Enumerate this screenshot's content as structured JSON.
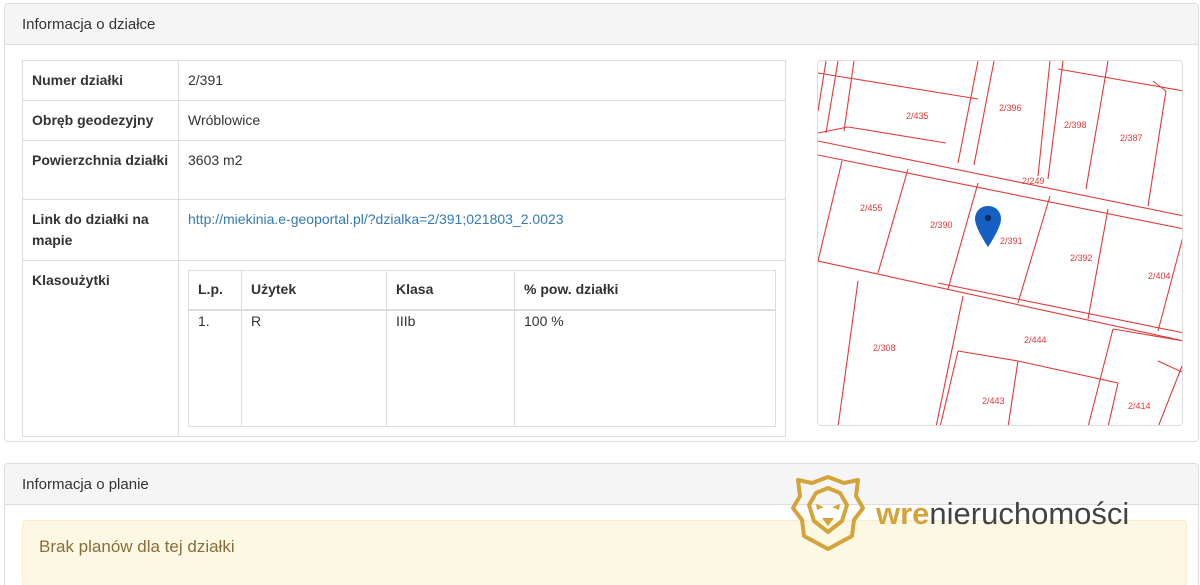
{
  "panel_parcel": {
    "title": "Informacja o działce",
    "rows": [
      {
        "label": "Numer działki",
        "value": "2/391"
      },
      {
        "label": "Obręb geodezyjny",
        "value": "Wróblowice"
      },
      {
        "label": "Powierzchnia działki",
        "value": "3603 m2"
      },
      {
        "label": "Link do działki na mapie",
        "value": "http://miekinia.e-geoportal.pl/?dzialka=2/391;021803_2.0023"
      }
    ],
    "klasouzytki": {
      "label": "Klasoużytki",
      "headers": [
        "L.p.",
        "Użytek",
        "Klasa",
        "% pow. działki"
      ],
      "rows": [
        [
          "1.",
          "R",
          "IIIb",
          "100 %"
        ]
      ]
    }
  },
  "map": {
    "parcel_labels": [
      "2/435",
      "2/396",
      "2/398",
      "2/387",
      "2/249",
      "2/455",
      "2/390",
      "2/391",
      "2/392",
      "2/404",
      "2/308",
      "2/444",
      "2/443",
      "2/414"
    ],
    "line_color": "#e03a3a",
    "marker_color": "#1560c2",
    "marker_icon": "map-pin-icon"
  },
  "panel_plan": {
    "title": "Informacja o planie",
    "alert": "Brak planów dla tej działki"
  },
  "logo": {
    "part1": "wre",
    "part2": "nieruchomości",
    "accent": "#d4a43a",
    "icon": "lion-head-icon"
  }
}
